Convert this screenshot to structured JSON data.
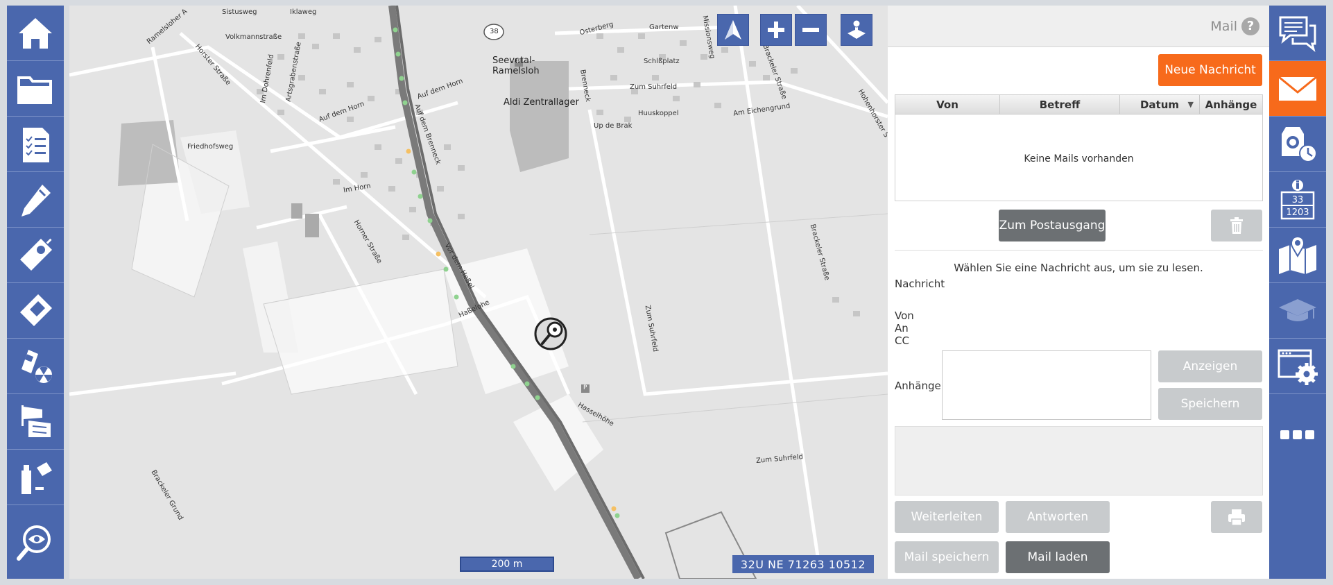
{
  "colors": {
    "sidebar_blue": "#4a67ad",
    "accent_orange": "#f76a1b",
    "button_dark": "#6c7073",
    "button_disabled": "#c8cbcd"
  },
  "left_sidebar": {
    "items": [
      {
        "icon": "home-icon"
      },
      {
        "icon": "folder-icon"
      },
      {
        "icon": "checklist-icon"
      },
      {
        "icon": "probe-pen-icon"
      },
      {
        "icon": "gas-detector-icon"
      },
      {
        "icon": "handheld-device-icon"
      },
      {
        "icon": "dosimeter-radiation-icon"
      },
      {
        "icon": "windsock-icon"
      },
      {
        "icon": "chemical-bottles-icon"
      },
      {
        "icon": "search-eye-icon"
      }
    ]
  },
  "map": {
    "buttons": [
      "compass-north-icon",
      "zoom-in-icon",
      "zoom-out-icon",
      "joystick-icon"
    ],
    "scale": "200 m",
    "coordinates": "32U NE 71263 10512",
    "labels": {
      "sistusweg": "Sistusweg",
      "iklaweg": "Iklaweg",
      "volkmannstrasse": "Volkmannstraße",
      "ramelsloher": "Ramelsloher A",
      "horster": "Horster Straße",
      "im_dohrenfeld": "Im Dohrenfeld",
      "artsgrabenstrasse": "Artsgrabenstraße",
      "auf_dem_horn_1": "Auf dem Horn",
      "auf_dem_horn_2": "Auf dem Horn",
      "auf_dem_brenneck": "Auf dem Brenneck",
      "friedhofsweg": "Friedhofsweg",
      "im_horn": "Im Horn",
      "horner_strasse": "Horner Straße",
      "vor_dem_hessel": "Vor dem Heßel",
      "hassellohe": "Haßelohe",
      "hasselhoehe": "Hasselhöhe",
      "seevetal": "Seevetal-\nRamelsloh",
      "aldi": "Aldi Zentrallager",
      "osterberg": "Osterberg",
      "gartenw": "Gartenw",
      "schlossplatz": "Schlßplatz",
      "zum_suhrfeld_top": "Zum Suhrfeld",
      "huuskoppel": "Huuskoppel",
      "up_de_brak": "Up de Brak",
      "am_eichengrund": "Am Eichengrund",
      "brackeler_strasse_top": "Brackeler Straße",
      "hohenhorster": "Hohenhorster S",
      "brackeler_strasse": "Brackeler Straße",
      "zum_suhrfeld_mid": "Zum Suhrfeld",
      "zum_suhrfeld_bottom": "Zum Suhrfeld",
      "brackeler_grund": "Brackeler Grund",
      "missionsweg": "Missionsweg",
      "brenneck": "Brenneck",
      "route_38": "38",
      "parking": "P"
    }
  },
  "mail": {
    "title": "Mail",
    "new_message": "Neue Nachricht",
    "table": {
      "columns": [
        "Von",
        "Betreff",
        "Datum",
        "Anhänge"
      ],
      "empty": "Keine Mails vorhanden"
    },
    "to_outbox": "Zum Postausgang",
    "select_hint": "Wählen Sie eine Nachricht aus, um sie zu lesen.",
    "fields": {
      "nachricht": "Nachricht",
      "von": "Von",
      "an": "An",
      "cc": "CC",
      "anhaenge": "Anhänge"
    },
    "show": "Anzeigen",
    "save": "Speichern",
    "forward": "Weiterleiten",
    "reply": "Antworten",
    "save_mail": "Mail speichern",
    "load_mail": "Mail laden"
  },
  "right_sidebar": {
    "items": [
      {
        "icon": "chat-bubbles-icon"
      },
      {
        "icon": "mail-icon",
        "active": true
      },
      {
        "icon": "breathing-apparatus-clock-icon"
      },
      {
        "icon": "info-placard-icon",
        "un_number_top": "33",
        "un_number_bottom": "1203"
      },
      {
        "icon": "map-pin-icon"
      },
      {
        "icon": "graduation-cap-icon"
      },
      {
        "icon": "settings-window-icon"
      },
      {
        "icon": "more-dots-icon"
      }
    ]
  }
}
